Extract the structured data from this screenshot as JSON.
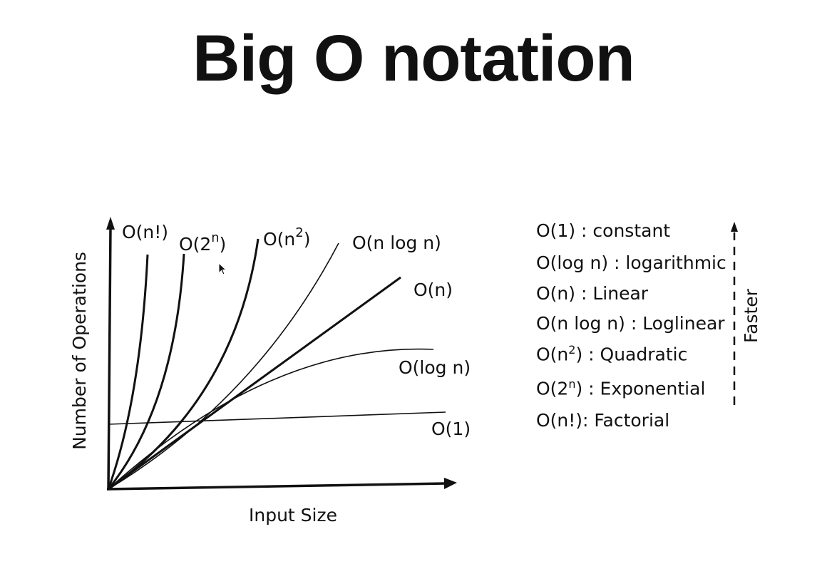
{
  "title": "Big O notation",
  "diagram": {
    "y_axis_label": "Number of Operations",
    "x_axis_label": "Input Size",
    "curves": [
      {
        "label_base": "O(n!)",
        "label_sup": ""
      },
      {
        "label_base": "O(2",
        "label_sup": "n",
        "label_tail": ")"
      },
      {
        "label_base": "O(n",
        "label_sup": "2",
        "label_tail": ")"
      },
      {
        "label_base": "O(n log n)",
        "label_sup": ""
      },
      {
        "label_base": "O(n)",
        "label_sup": ""
      },
      {
        "label_base": "O(log n)",
        "label_sup": ""
      },
      {
        "label_base": "O(1)",
        "label_sup": ""
      }
    ]
  },
  "legend": {
    "rows": [
      {
        "pre": "O(1) : constant"
      },
      {
        "pre": "O(log n) : logarithmic"
      },
      {
        "pre": "O(n) : Linear"
      },
      {
        "pre": "O(n log n) : Loglinear"
      },
      {
        "pre": "O(n",
        "sup": "2",
        "post": ") : Quadratic"
      },
      {
        "pre": "O(2",
        "sup": "n",
        "post": ") : Exponential"
      },
      {
        "pre": "O(n!): Factorial"
      }
    ],
    "arrow_label": "Faster"
  }
}
